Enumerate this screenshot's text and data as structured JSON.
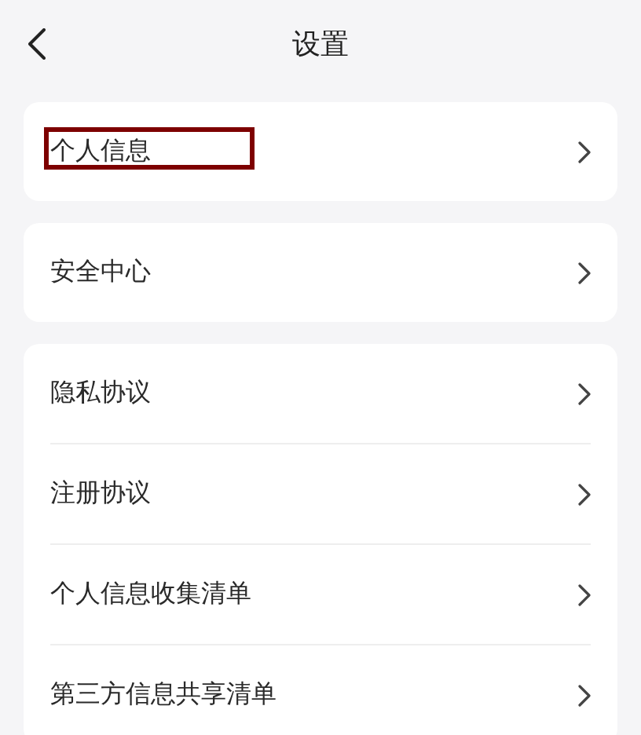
{
  "header": {
    "title": "设置"
  },
  "groups": [
    {
      "items": [
        {
          "label": "个人信息"
        }
      ]
    },
    {
      "items": [
        {
          "label": "安全中心"
        }
      ]
    },
    {
      "items": [
        {
          "label": "隐私协议"
        },
        {
          "label": "注册协议"
        },
        {
          "label": "个人信息收集清单"
        },
        {
          "label": "第三方信息共享清单"
        }
      ]
    }
  ]
}
